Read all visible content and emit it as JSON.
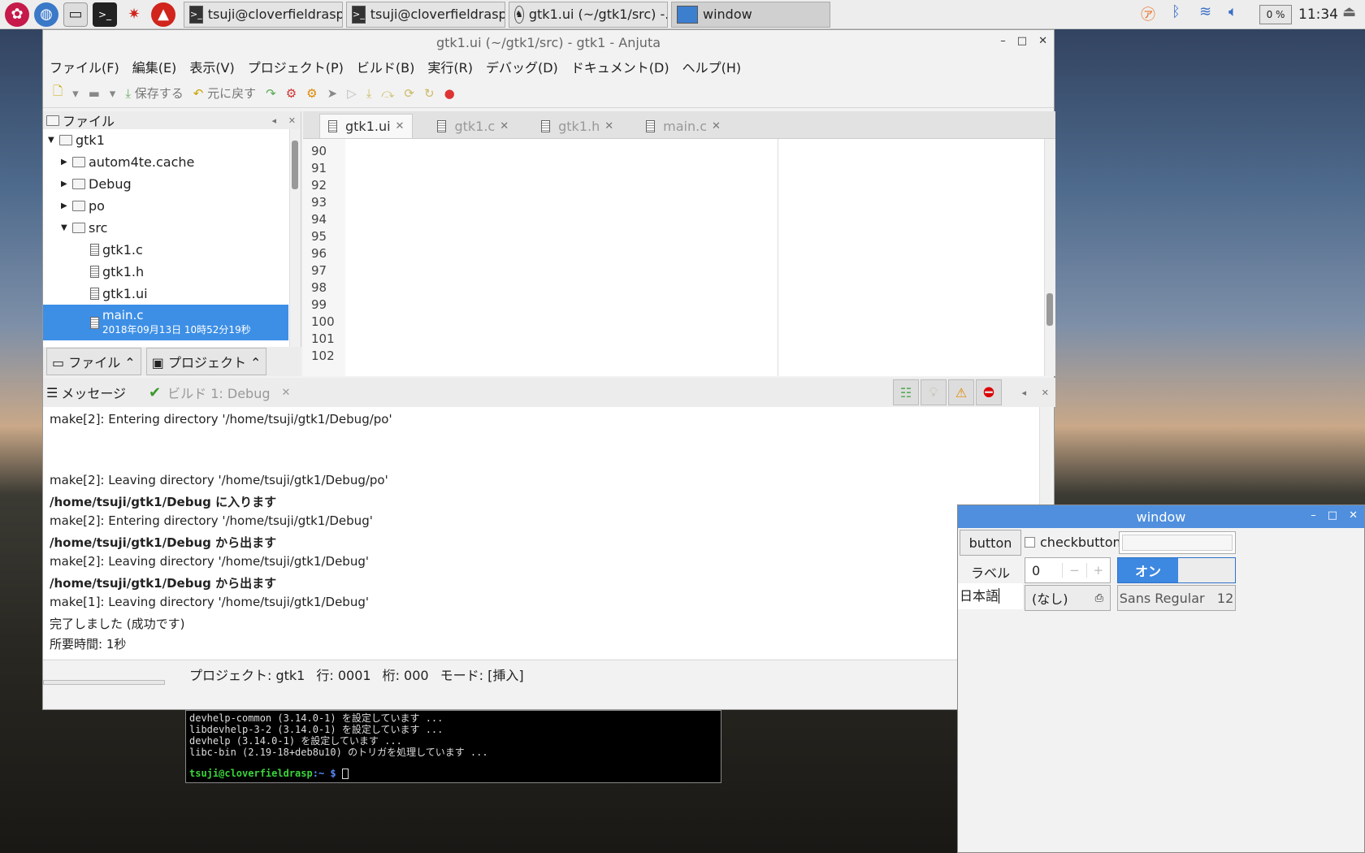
{
  "taskbar": {
    "tasks": [
      {
        "label": "tsuji@cloverfieldrasp..."
      },
      {
        "label": "tsuji@cloverfieldrasp..."
      },
      {
        "label": "gtk1.ui (~/gtk1/src) -..."
      },
      {
        "label": "window"
      }
    ],
    "cpu": "0 %",
    "clock": "11:34"
  },
  "anjuta": {
    "title": "gtk1.ui (~/gtk1/src) - gtk1 - Anjuta",
    "menu": [
      "ファイル(F)",
      "編集(E)",
      "表示(V)",
      "プロジェクト(P)",
      "ビルド(B)",
      "実行(R)",
      "デバッグ(D)",
      "ドキュメント(D)",
      "ヘルプ(H)"
    ],
    "toolbar": {
      "save": "保存する",
      "undo": "元に戻す"
    },
    "files_panel": {
      "title": "ファイル",
      "tree": [
        {
          "label": "gtk1",
          "kind": "folder",
          "level": 0,
          "expanded": true
        },
        {
          "label": "autom4te.cache",
          "kind": "folder",
          "level": 1,
          "expanded": false
        },
        {
          "label": "Debug",
          "kind": "folder",
          "level": 1,
          "expanded": false
        },
        {
          "label": "po",
          "kind": "folder",
          "level": 1,
          "expanded": false
        },
        {
          "label": "src",
          "kind": "folder",
          "level": 1,
          "expanded": true
        },
        {
          "label": "gtk1.c",
          "kind": "file",
          "level": 2
        },
        {
          "label": "gtk1.h",
          "kind": "file",
          "level": 2
        },
        {
          "label": "gtk1.ui",
          "kind": "file",
          "level": 2
        }
      ],
      "selected": {
        "label": "main.c",
        "detail": "2018年09月13日 10時52分19秒"
      },
      "tabs": [
        "ファイル ⌃",
        "プロジェクト ⌃"
      ]
    },
    "editor": {
      "tabs": [
        {
          "label": "gtk1.ui",
          "active": true
        },
        {
          "label": "gtk1.c",
          "active": false
        },
        {
          "label": "gtk1.h",
          "active": false
        },
        {
          "label": "main.c",
          "active": false
        }
      ],
      "line_numbers": [
        "90",
        "91",
        "92",
        "93",
        "94",
        "95",
        "96",
        "97",
        "98",
        "99",
        "100",
        "101",
        "102"
      ]
    },
    "messages": {
      "title": "メッセージ",
      "build_tab": "ビルド 1: Debug",
      "lines": [
        {
          "text": "make[2]: Entering directory '/home/tsuji/gtk1/Debug/po'",
          "bold": false
        },
        {
          "text": "",
          "bold": false
        },
        {
          "text": "",
          "bold": false
        },
        {
          "text": "make[2]: Leaving directory '/home/tsuji/gtk1/Debug/po'",
          "bold": false
        },
        {
          "text": "/home/tsuji/gtk1/Debug に入ります",
          "bold": true
        },
        {
          "text": "make[2]: Entering directory '/home/tsuji/gtk1/Debug'",
          "bold": false
        },
        {
          "text": "/home/tsuji/gtk1/Debug から出ます",
          "bold": true
        },
        {
          "text": "make[2]: Leaving directory '/home/tsuji/gtk1/Debug'",
          "bold": false
        },
        {
          "text": "/home/tsuji/gtk1/Debug から出ます",
          "bold": true
        },
        {
          "text": "make[1]: Leaving directory '/home/tsuji/gtk1/Debug'",
          "bold": false
        },
        {
          "text": "完了しました (成功です)",
          "bold": false
        },
        {
          "text": "所要時間: 1秒",
          "bold": false
        }
      ]
    },
    "status": {
      "project": "プロジェクト: gtk1",
      "line": "行: 0001",
      "col": "桁: 000",
      "mode": "モード: [挿入]"
    }
  },
  "terminal": {
    "lines": [
      "devhelp-common (3.14.0-1) を設定しています ...",
      "libdevhelp-3-2 (3.14.0-1) を設定しています ...",
      "devhelp (3.14.0-1) を設定しています ...",
      "libc-bin (2.19-18+deb8u10) のトリガを処理しています ..."
    ],
    "prompt": "tsuji@cloverfieldrasp",
    "prompt_tail": ":~ $"
  },
  "gtkwin": {
    "title": "window",
    "button": "button",
    "checkbutton": "checkbutton",
    "label": "ラベル",
    "spin_value": "0",
    "switch_on": "オン",
    "text_value": "日本語",
    "file_chooser": "(なし)",
    "font": "Sans Regular",
    "font_size": "12"
  }
}
